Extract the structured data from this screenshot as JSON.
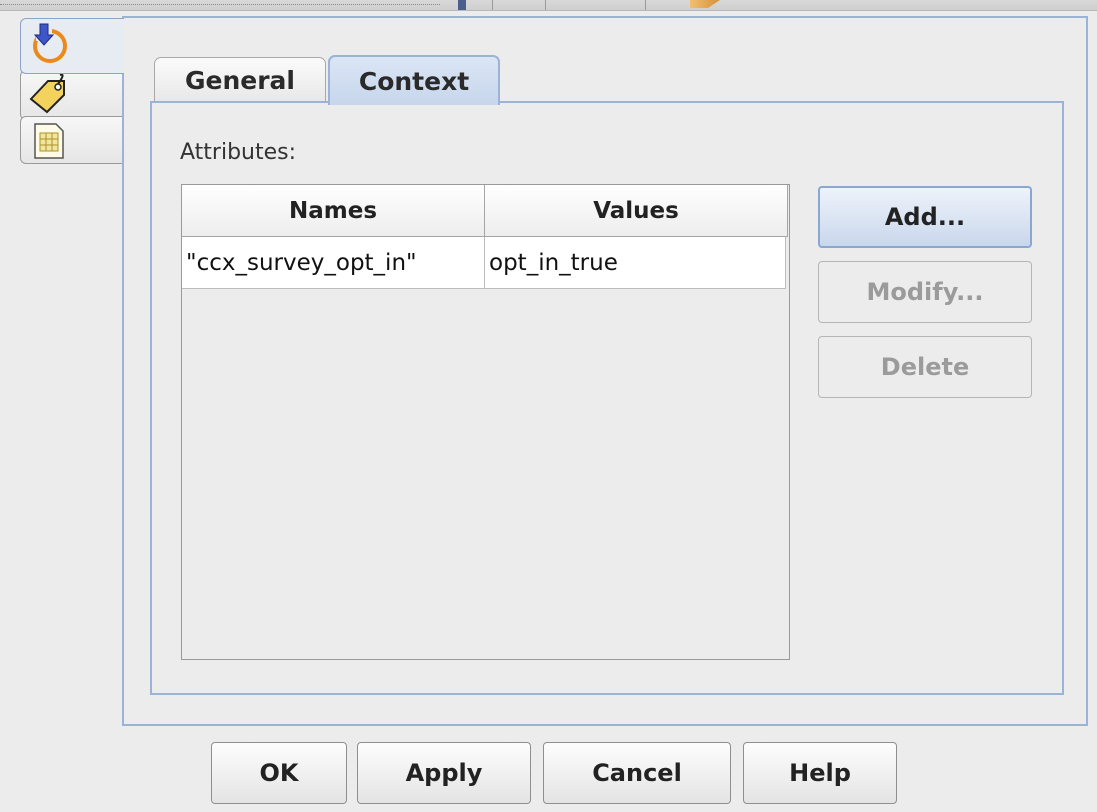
{
  "tabs": [
    {
      "label": "General",
      "active": false
    },
    {
      "label": "Context",
      "active": true
    }
  ],
  "side_tabs": [
    {
      "icon": "refresh-arrow-icon",
      "active": true
    },
    {
      "icon": "tag-icon",
      "active": false
    },
    {
      "icon": "document-icon",
      "active": false
    }
  ],
  "attributes": {
    "label": "Attributes:",
    "columns": [
      "Names",
      "Values"
    ],
    "rows": [
      {
        "name": "\"ccx_survey_opt_in\"",
        "value": "opt_in_true"
      }
    ]
  },
  "actions": {
    "add": "Add...",
    "modify": "Modify...",
    "delete": "Delete"
  },
  "footer": {
    "ok": "OK",
    "apply": "Apply",
    "cancel": "Cancel",
    "help": "Help"
  },
  "colors": {
    "accent_border": "#9cb3d8",
    "active_tab": "#c7d6ec",
    "disabled_text": "#9b9b9b"
  }
}
